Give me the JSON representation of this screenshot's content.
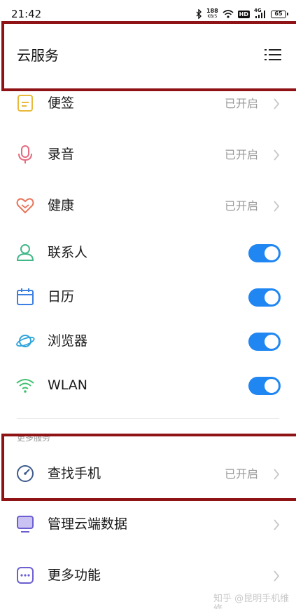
{
  "status_bar": {
    "time": "21:42",
    "net_speed_value": "188",
    "net_speed_unit": "KB/S",
    "hd_label": "HD",
    "signal_label": "4G",
    "battery": "65"
  },
  "header": {
    "title": "云服务",
    "menu_icon": "list-menu-icon"
  },
  "apps": [
    {
      "label": "便签",
      "status": "已开启",
      "control": "chevron",
      "icon": "notes-icon",
      "color": "#e8b93a"
    },
    {
      "label": "录音",
      "status": "已开启",
      "control": "chevron",
      "icon": "microphone-icon",
      "color": "#e66b7f"
    },
    {
      "label": "健康",
      "status": "已开启",
      "control": "chevron",
      "icon": "heart-icon",
      "color": "#e8755a"
    },
    {
      "label": "联系人",
      "status": "",
      "control": "toggle",
      "enabled": true,
      "icon": "contact-icon",
      "color": "#42b889"
    },
    {
      "label": "日历",
      "status": "",
      "control": "toggle",
      "enabled": true,
      "icon": "calendar-icon",
      "color": "#3b7fe0"
    },
    {
      "label": "浏览器",
      "status": "",
      "control": "toggle",
      "enabled": true,
      "icon": "browser-planet-icon",
      "color": "#2fa5d9"
    },
    {
      "label": "WLAN",
      "status": "",
      "control": "toggle",
      "enabled": true,
      "icon": "wifi-icon",
      "color": "#3fc070"
    }
  ],
  "more_services": {
    "section_label": "更多服务",
    "items": [
      {
        "label": "查找手机",
        "status": "已开启",
        "control": "chevron",
        "icon": "compass-icon",
        "color": "#3d5a8c"
      },
      {
        "label": "管理云端数据",
        "status": "",
        "control": "chevron",
        "icon": "monitor-icon",
        "color": "#6b5fd1"
      },
      {
        "label": "更多功能",
        "status": "",
        "control": "chevron",
        "icon": "more-dots-icon",
        "color": "#6b5fd1"
      }
    ]
  },
  "watermark": "知乎 @昆明手机维修",
  "highlight_color": "#8f1215",
  "toggle_color": "#1f86f2"
}
